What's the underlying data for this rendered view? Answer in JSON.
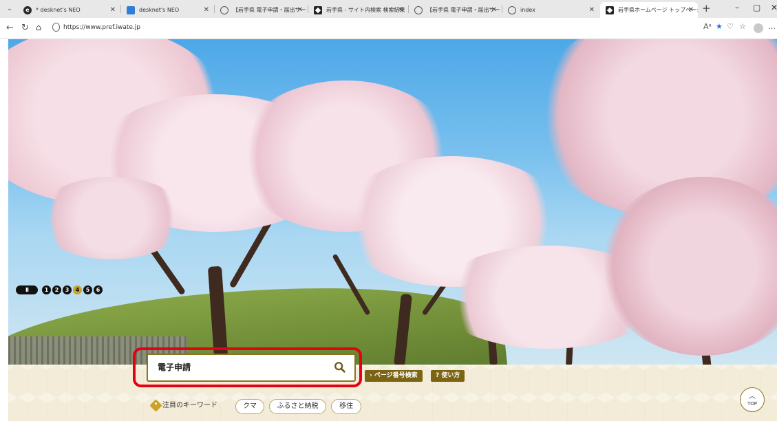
{
  "browser": {
    "tabs": [
      {
        "label": "* desknet's NEO",
        "icon": "edge-icon"
      },
      {
        "label": "desknet's NEO",
        "icon": "desknets-icon"
      },
      {
        "label": "【岩手県 電子申請・届出サービス】申請",
        "icon": "globe-icon"
      },
      {
        "label": "岩手県 - サイト内検索 検索結果",
        "icon": "iwate-icon"
      },
      {
        "label": "【岩手県 電子申請・届出サービス】利",
        "icon": "globe-icon"
      },
      {
        "label": "index",
        "icon": "globe-icon"
      },
      {
        "label": "岩手県ホームページ トップページ",
        "icon": "iwate-icon"
      }
    ],
    "active_tab_index": 6,
    "url": "https://www.pref.iwate.jp"
  },
  "hero": {
    "pause_label": "II",
    "slides": [
      "1",
      "2",
      "3",
      "4",
      "5",
      "6"
    ],
    "current_slide": 4
  },
  "search": {
    "value": "電子申請",
    "highlight_color": "#e50012"
  },
  "buttons": {
    "page_number_search": "ページ番号検索",
    "page_number_prefix": "›",
    "how_to_use": "使い方",
    "how_to_use_prefix": "?"
  },
  "keywords": {
    "label": "注目のキーワード",
    "items": [
      "クマ",
      "ふるさと納税",
      "移住"
    ]
  },
  "top_button": {
    "label": "TOP"
  },
  "colors": {
    "accent_gold": "#7b6414",
    "active_dot": "#c9a227",
    "band_bg": "#f3ecd8"
  }
}
